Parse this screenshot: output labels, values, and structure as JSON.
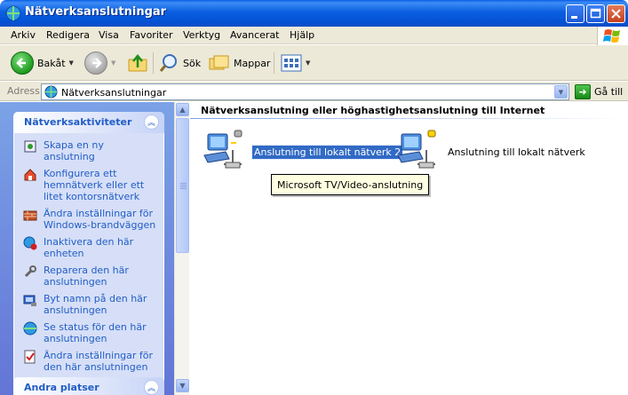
{
  "window": {
    "title": "Nätverksanslutningar"
  },
  "menu": [
    "Arkiv",
    "Redigera",
    "Visa",
    "Favoriter",
    "Verktyg",
    "Avancerat",
    "Hjälp"
  ],
  "toolbar": {
    "back_label": "Bakåt",
    "search_label": "Sök",
    "folders_label": "Mappar"
  },
  "address": {
    "label": "Adress",
    "value": "Nätverksanslutningar",
    "go_label": "Gå till"
  },
  "left_pane": {
    "network_tasks": {
      "title": "Nätverksaktiviteter",
      "items": [
        {
          "label": "Skapa en ny anslutning",
          "icon": "new-connection-icon"
        },
        {
          "label": "Konfigurera ett hemnätverk eller ett litet kontorsnätverk",
          "icon": "home-network-icon"
        },
        {
          "label": "Ändra inställningar för Windows-brandväggen",
          "icon": "firewall-icon"
        },
        {
          "label": "Inaktivera den här enheten",
          "icon": "disable-device-icon"
        },
        {
          "label": "Reparera den här anslutningen",
          "icon": "repair-icon"
        },
        {
          "label": "Byt namn på den här anslutningen",
          "icon": "rename-icon"
        },
        {
          "label": "Se status för den här anslutningen",
          "icon": "status-icon"
        },
        {
          "label": "Ändra inställningar för den här anslutningen",
          "icon": "settings-icon"
        }
      ]
    },
    "other_places": {
      "title": "Andra platser"
    }
  },
  "content": {
    "group_heading": "Nätverksanslutning eller höghastighetsanslutning till Internet",
    "items": [
      {
        "label": "Anslutning till lokalt nätverk 2",
        "selected": true
      },
      {
        "label": "Anslutning till lokalt nätverk",
        "selected": false
      }
    ],
    "tooltip": "Microsoft TV/Video-anslutning"
  }
}
